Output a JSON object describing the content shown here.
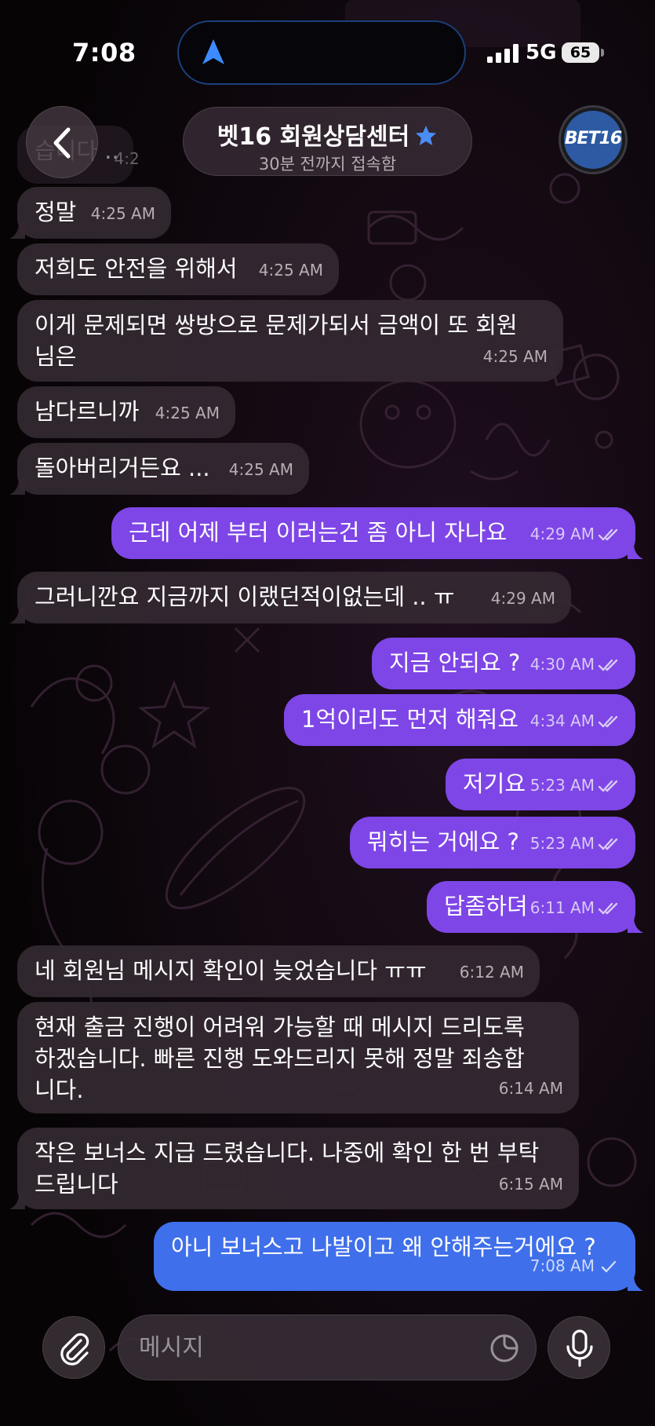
{
  "status_bar": {
    "time": "7:08",
    "network": "5G",
    "battery": "65",
    "location_icon": "navigation-arrow-icon"
  },
  "header": {
    "back_icon": "chevron-left-icon",
    "title": "벳16 회원상담센터",
    "title_badge_icon": "star-icon",
    "subtitle": "30분 전까지 접속함",
    "avatar_text": "BET16"
  },
  "partial_top_message": {
    "text": "습니다 ..",
    "time": "4:2"
  },
  "messages": [
    {
      "dir": "in",
      "text": "정말",
      "time": "4:25 AM"
    },
    {
      "dir": "in",
      "text": "저희도 안전을 위해서",
      "time": "4:25 AM"
    },
    {
      "dir": "in",
      "text": "이게 문제되면 쌍방으로 문제가되서 금액이 또 회원\n님은",
      "time": "4:25 AM"
    },
    {
      "dir": "in",
      "text": "남다르니까",
      "time": "4:25 AM"
    },
    {
      "dir": "in",
      "text": "돌아버리거든요 ...",
      "time": "4:25 AM"
    },
    {
      "dir": "out",
      "text": "근데 어제 부터 이러는건 좀 아니 자나요",
      "time": "4:29 AM",
      "status": "read"
    },
    {
      "dir": "in",
      "text": "그러니깐요 지금까지 이랬던적이없는데 .. ㅠ",
      "time": "4:29 AM"
    },
    {
      "dir": "out",
      "text": "지금 안되요 ?",
      "time": "4:30 AM",
      "status": "read"
    },
    {
      "dir": "out",
      "text": "1억이리도 먼저 해줘요",
      "time": "4:34 AM",
      "status": "read"
    },
    {
      "dir": "out",
      "text": "저기요",
      "time": "5:23 AM",
      "status": "read"
    },
    {
      "dir": "out",
      "text": "뭐히는 거에요 ?",
      "time": "5:23 AM",
      "status": "read"
    },
    {
      "dir": "out",
      "text": "답좀하뎌",
      "time": "6:11 AM",
      "status": "read"
    },
    {
      "dir": "in",
      "text": "네 회원님 메시지 확인이 늦었습니다 ㅠㅠ",
      "time": "6:12 AM"
    },
    {
      "dir": "in",
      "text": "현재 출금 진행이 어려워 가능할 때 메시지 드리도록\n하겠습니다. 빠른 진행 도와드리지 못해 정말 죄송합\n니다.",
      "time": "6:14 AM"
    },
    {
      "dir": "in",
      "text": "작은 보너스 지급 드렸습니다. 나중에 확인 한 번 부탁\n드립니다",
      "time": "6:15 AM"
    },
    {
      "dir": "out",
      "text": "아니 보너스고 나발이고 왜 안해주는거에요 ?",
      "time": "7:08 AM",
      "status": "sent"
    }
  ],
  "input": {
    "placeholder": "메시지",
    "attach_icon": "paperclip-icon",
    "sticker_icon": "sticker-icon",
    "mic_icon": "microphone-icon"
  },
  "colors": {
    "outgoing_bubble": "#7e46e6",
    "outgoing_bubble_last": "#3f6fea",
    "incoming_bubble": "#342932",
    "background": "#0b0709",
    "accent_star": "#4b8cf5"
  }
}
